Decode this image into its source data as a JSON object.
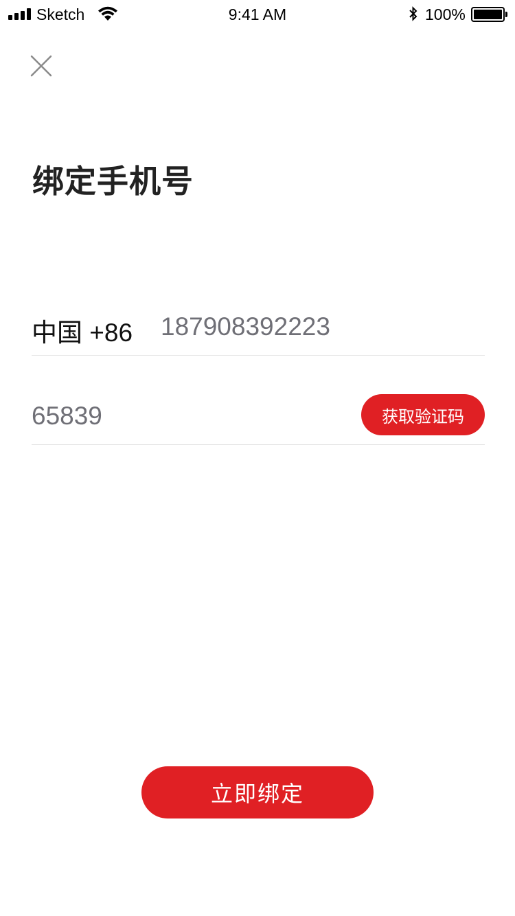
{
  "status_bar": {
    "carrier": "Sketch",
    "time": "9:41 AM",
    "battery": "100%",
    "icons": [
      "signal-icon",
      "wifi-icon",
      "bluetooth-icon",
      "battery-icon"
    ]
  },
  "header": {
    "close_icon": "close-icon",
    "title": "绑定手机号"
  },
  "form": {
    "country_code": "中国 +86",
    "phone_value": "187908392223",
    "code_value": "65839",
    "get_code_label": "获取验证码"
  },
  "actions": {
    "bind_label": "立即绑定"
  },
  "colors": {
    "accent": "#e02024",
    "input_text": "#6f6f76",
    "divider": "#e5e5e5"
  }
}
